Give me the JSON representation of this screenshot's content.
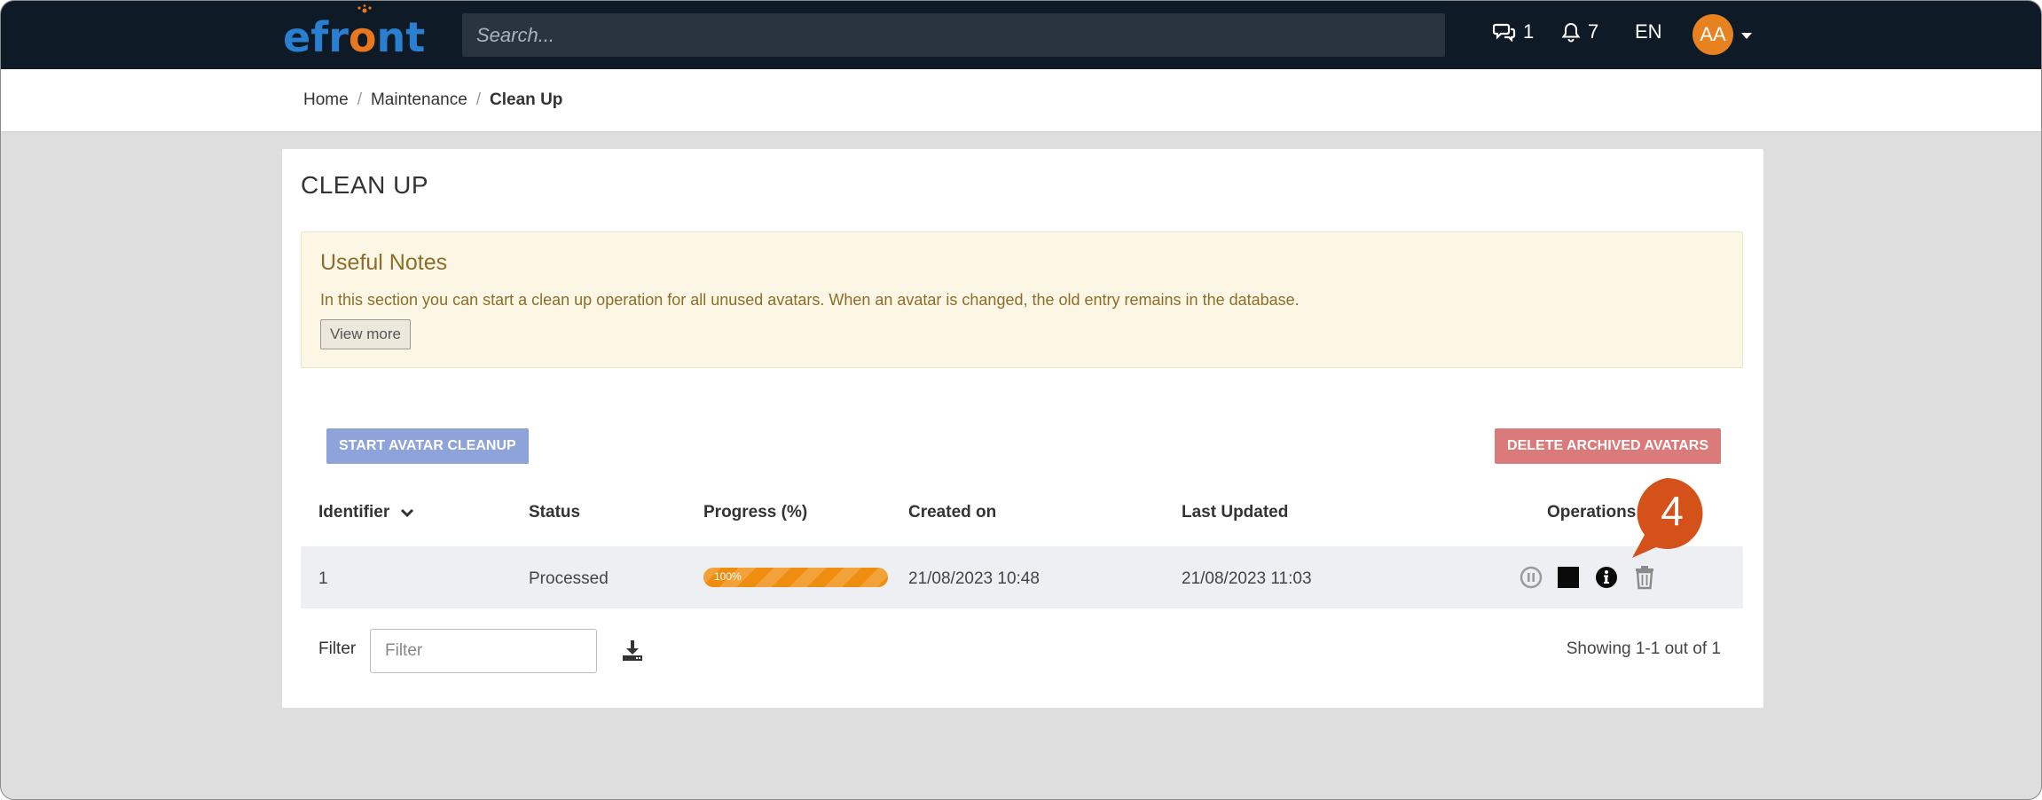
{
  "header": {
    "logo_text": "efront",
    "search_placeholder": "Search...",
    "messages_count": "1",
    "notifications_count": "7",
    "language": "EN",
    "avatar_initials": "AA"
  },
  "breadcrumb": {
    "items": [
      "Home",
      "Maintenance",
      "Clean Up"
    ],
    "separator": "/"
  },
  "page": {
    "title": "CLEAN UP"
  },
  "notes": {
    "title": "Useful Notes",
    "text": "In this section you can start a clean up operation for all unused avatars. When an avatar is changed, the old entry remains in the database.",
    "view_more": "View more"
  },
  "actions": {
    "start_label": "START AVATAR CLEANUP",
    "delete_label": "DELETE ARCHIVED AVATARS"
  },
  "table": {
    "columns": [
      "Identifier",
      "Status",
      "Progress (%)",
      "Created on",
      "Last Updated",
      "Operations"
    ],
    "rows": [
      {
        "identifier": "1",
        "status": "Processed",
        "progress": 100,
        "progress_label": "100%",
        "created_on": "21/08/2023 10:48",
        "last_updated": "21/08/2023 11:03",
        "operations": [
          "pause-icon",
          "stop-icon",
          "info-icon",
          "trash-icon"
        ]
      }
    ]
  },
  "footer": {
    "filter_label": "Filter",
    "filter_placeholder": "Filter",
    "showing": "Showing 1-1 out of 1"
  },
  "callout": {
    "number": "4",
    "color": "#d4521a"
  },
  "colors": {
    "topbar": "#0e1a26",
    "logo_blue": "#2a7fd0",
    "logo_orange": "#e8771f",
    "start_button": "#8da3d9",
    "delete_button": "#da7a7a",
    "notes_bg": "#fcf7e4",
    "progress": "#ee8d10"
  }
}
